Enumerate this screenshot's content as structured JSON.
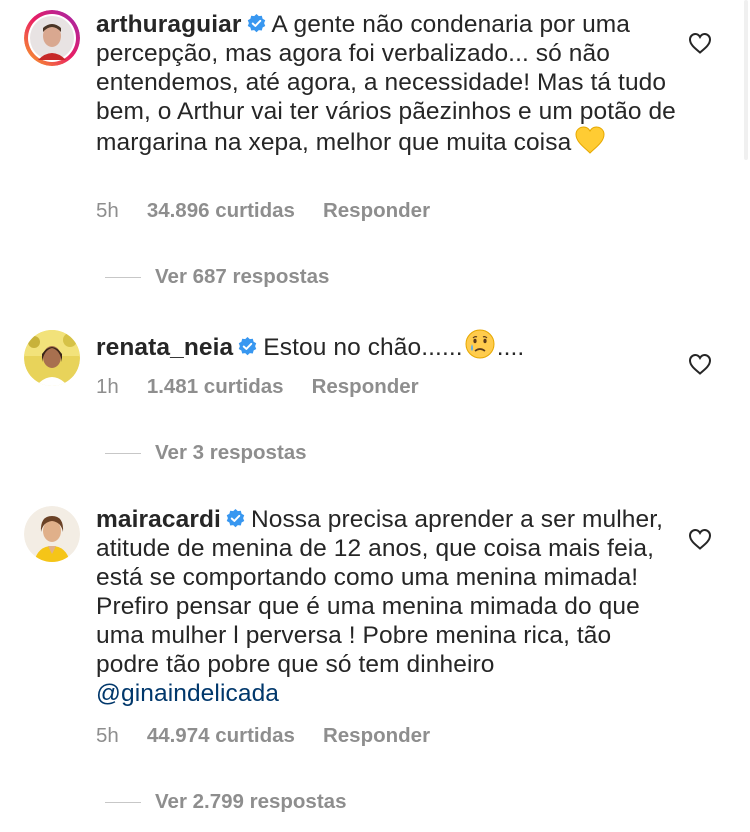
{
  "comments": [
    {
      "username": "arthuraguiar",
      "verified": true,
      "text": "A gente não condenaria por uma percepção, mas agora foi verbalizado... só não entendemos, até agora, a necessidade! Mas tá tudo bem, o Arthur vai ter vários pãezinhos e um potão de margarina na xepa, melhor que muita coisa",
      "emoji": "yellow-heart-icon",
      "time": "5h",
      "likes": "34.896 curtidas",
      "reply_label": "Responder",
      "view_replies": "Ver 687 respostas"
    },
    {
      "username": "renata_neia",
      "verified": true,
      "text": "Estou no chão......",
      "emoji": "crying-face-icon",
      "text_after": "....",
      "time": "1h",
      "likes": "1.481 curtidas",
      "reply_label": "Responder",
      "view_replies": "Ver 3 respostas"
    },
    {
      "username": "mairacardi",
      "verified": true,
      "text": "Nossa precisa aprender a ser mulher, atitude de menina de 12 anos, que coisa mais feia, está se comportando como uma menina mimada! Prefiro pensar que é uma menina mimada do que uma mulher l perversa ! Pobre menina rica, tão podre tão pobre que só tem dinheiro",
      "mention": "@ginaindelicada",
      "time": "5h",
      "likes": "44.974 curtidas",
      "reply_label": "Responder",
      "view_replies": "Ver 2.799 respostas"
    }
  ],
  "colors": {
    "text": "#262626",
    "meta": "#8e8e8e",
    "mention": "#00376b",
    "verified": "#3897f0"
  }
}
